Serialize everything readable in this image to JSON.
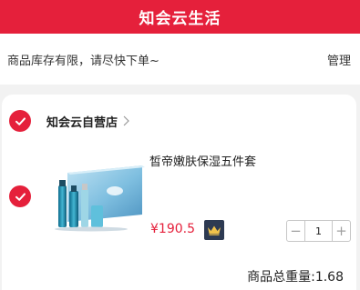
{
  "header": {
    "title": "知会云生活"
  },
  "notice": {
    "text": "商品库存有限，请尽快下单~",
    "manage_label": "管理"
  },
  "store": {
    "name": "知会云自营店",
    "checked": true
  },
  "cart_item": {
    "title": "皙帝嫩肤保湿五件套",
    "price": "¥190.5",
    "quantity": "1",
    "checked": true,
    "decrement_symbol": "−",
    "increment_symbol": "+"
  },
  "summary": {
    "total_weight_text": "商品总重量:1.68"
  },
  "icons": {
    "check": "check-circle-icon",
    "chevron": "chevron-right-icon",
    "vip": "crown-icon"
  },
  "colors": {
    "brand": "#e5203b",
    "text": "#222222",
    "vip_bg": "#2d3a52",
    "vip_crown": "#f0c24b"
  }
}
